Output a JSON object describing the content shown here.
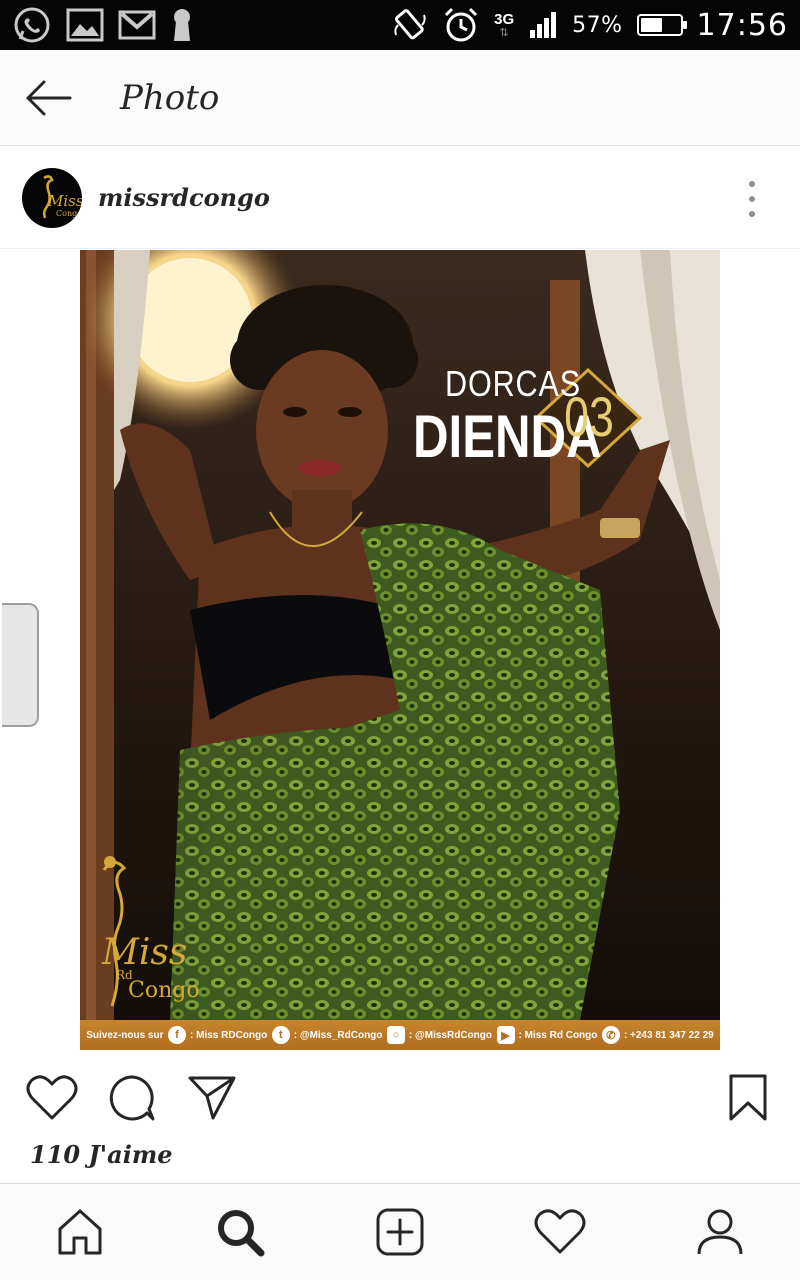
{
  "status_bar": {
    "icons_left": [
      "whatsapp-icon",
      "gallery-icon",
      "gmail-icon",
      "keyhole-icon"
    ],
    "icons_right": [
      "rotation-icon",
      "alarm-icon"
    ],
    "network": "3G",
    "battery_text": "57%",
    "battery_level": 0.57,
    "time": "17:56"
  },
  "app_bar": {
    "title": "Photo"
  },
  "post": {
    "username": "missrdcongo",
    "photo": {
      "first_name": "DORCAS",
      "last_name": "DIENDA",
      "number": "03",
      "logo_text": "Miss",
      "logo_rd": "Rd",
      "logo_congo": "Congo",
      "footer": {
        "follow": "Suivez-nous sur",
        "facebook": ": Miss RDCongo",
        "twitter": ": @Miss_RdCongo",
        "instagram": ": @MissRdCongo",
        "youtube": ": Miss Rd Congo",
        "phone": ": +243 81 347 22 29"
      }
    },
    "likes": "110 J'aime"
  },
  "colors": {
    "status_bar_bg": "#050505",
    "app_bar_bg": "#fafafa",
    "gold": "#d4a93a",
    "number_gold": "#e6cc73",
    "footer_band": "#c8852e"
  }
}
